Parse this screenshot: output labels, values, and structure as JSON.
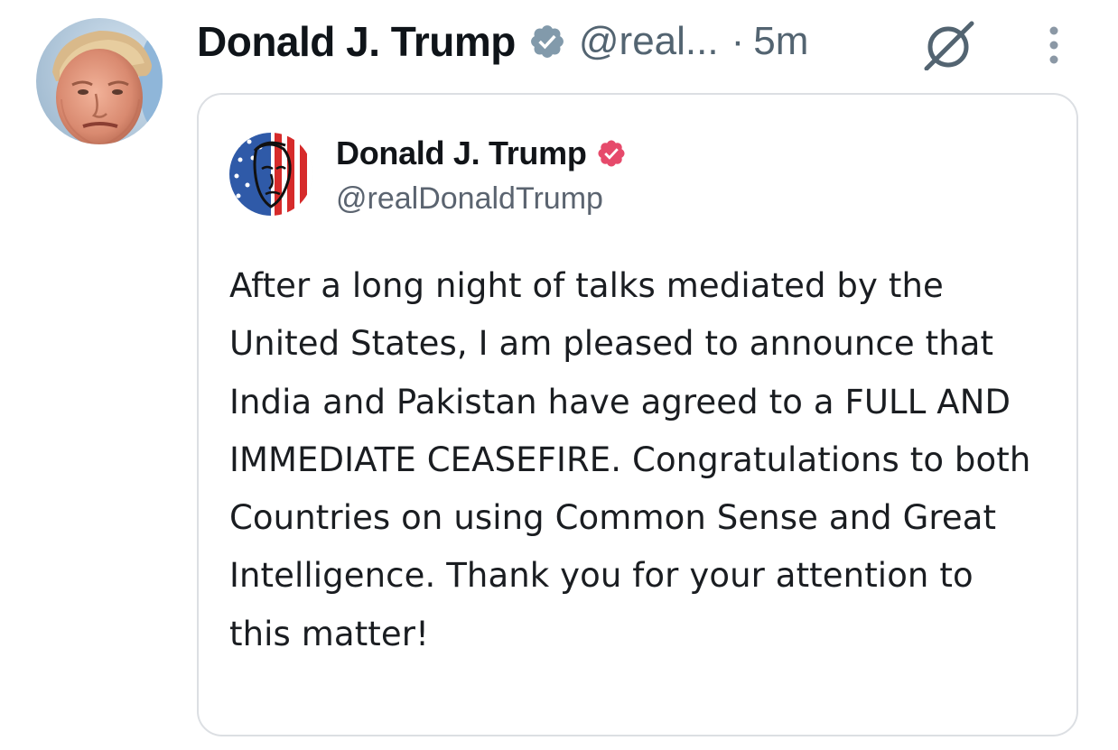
{
  "tweet": {
    "author": {
      "display_name": "Donald J. Trump",
      "handle": "@real...",
      "verified_badge": "verified-badge-icon",
      "avatar": "profile-photo"
    },
    "separator": "·",
    "time": "5m",
    "actions": {
      "grok_icon": "grok-icon",
      "more_icon": "more-vertical-icon"
    },
    "quote": {
      "author": {
        "display_name": "Donald J. Trump",
        "handle": "@realDonaldTrump",
        "verified_badge": "verified-badge-icon",
        "avatar": "stars-and-stripes-portrait"
      },
      "body": "After a long night of talks mediated by the United States, I am pleased to announce that India and Pakistan have agreed to a FULL AND IMMEDIATE CEASEFIRE. Congratulations to both Countries on using Common Sense and Great Intelligence. Thank you for your attention to this matter!"
    }
  },
  "colors": {
    "text_primary": "#0f1419",
    "text_secondary": "#536471",
    "verified_main": "#829aab",
    "verified_quote": "#e64a6b",
    "border": "#dcdfe3"
  }
}
